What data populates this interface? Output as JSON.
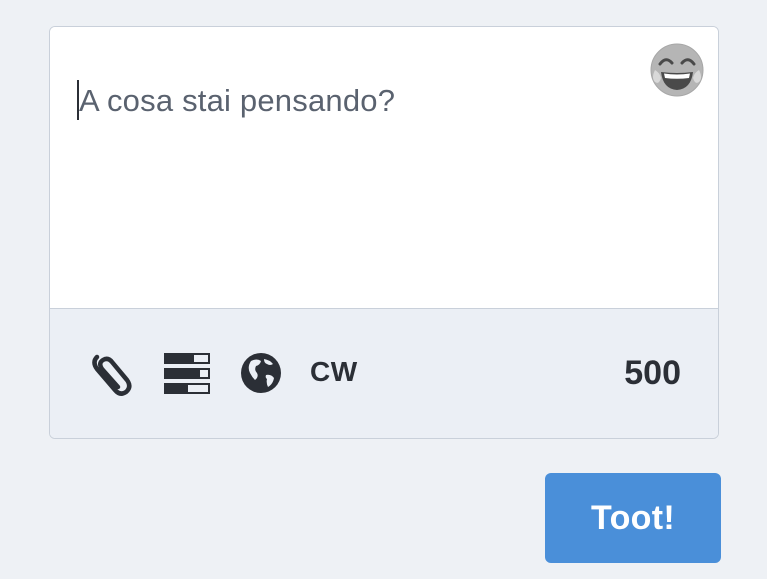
{
  "composer": {
    "placeholder": "A cosa stai pensando?",
    "emoji_icon": "laughing-emoji-icon",
    "toolbar": {
      "attach_icon": "paperclip-icon",
      "poll_icon": "poll-bars-icon",
      "visibility_icon": "globe-icon",
      "cw_label": "CW",
      "char_count": "500"
    }
  },
  "actions": {
    "toot_label": "Toot!"
  },
  "colors": {
    "background": "#eef1f5",
    "toolbar_background": "#ebeff5",
    "border": "#c9d0da",
    "accent": "#4a8fd9",
    "text_dark": "#2b2f36",
    "placeholder_text": "#5a626f"
  }
}
